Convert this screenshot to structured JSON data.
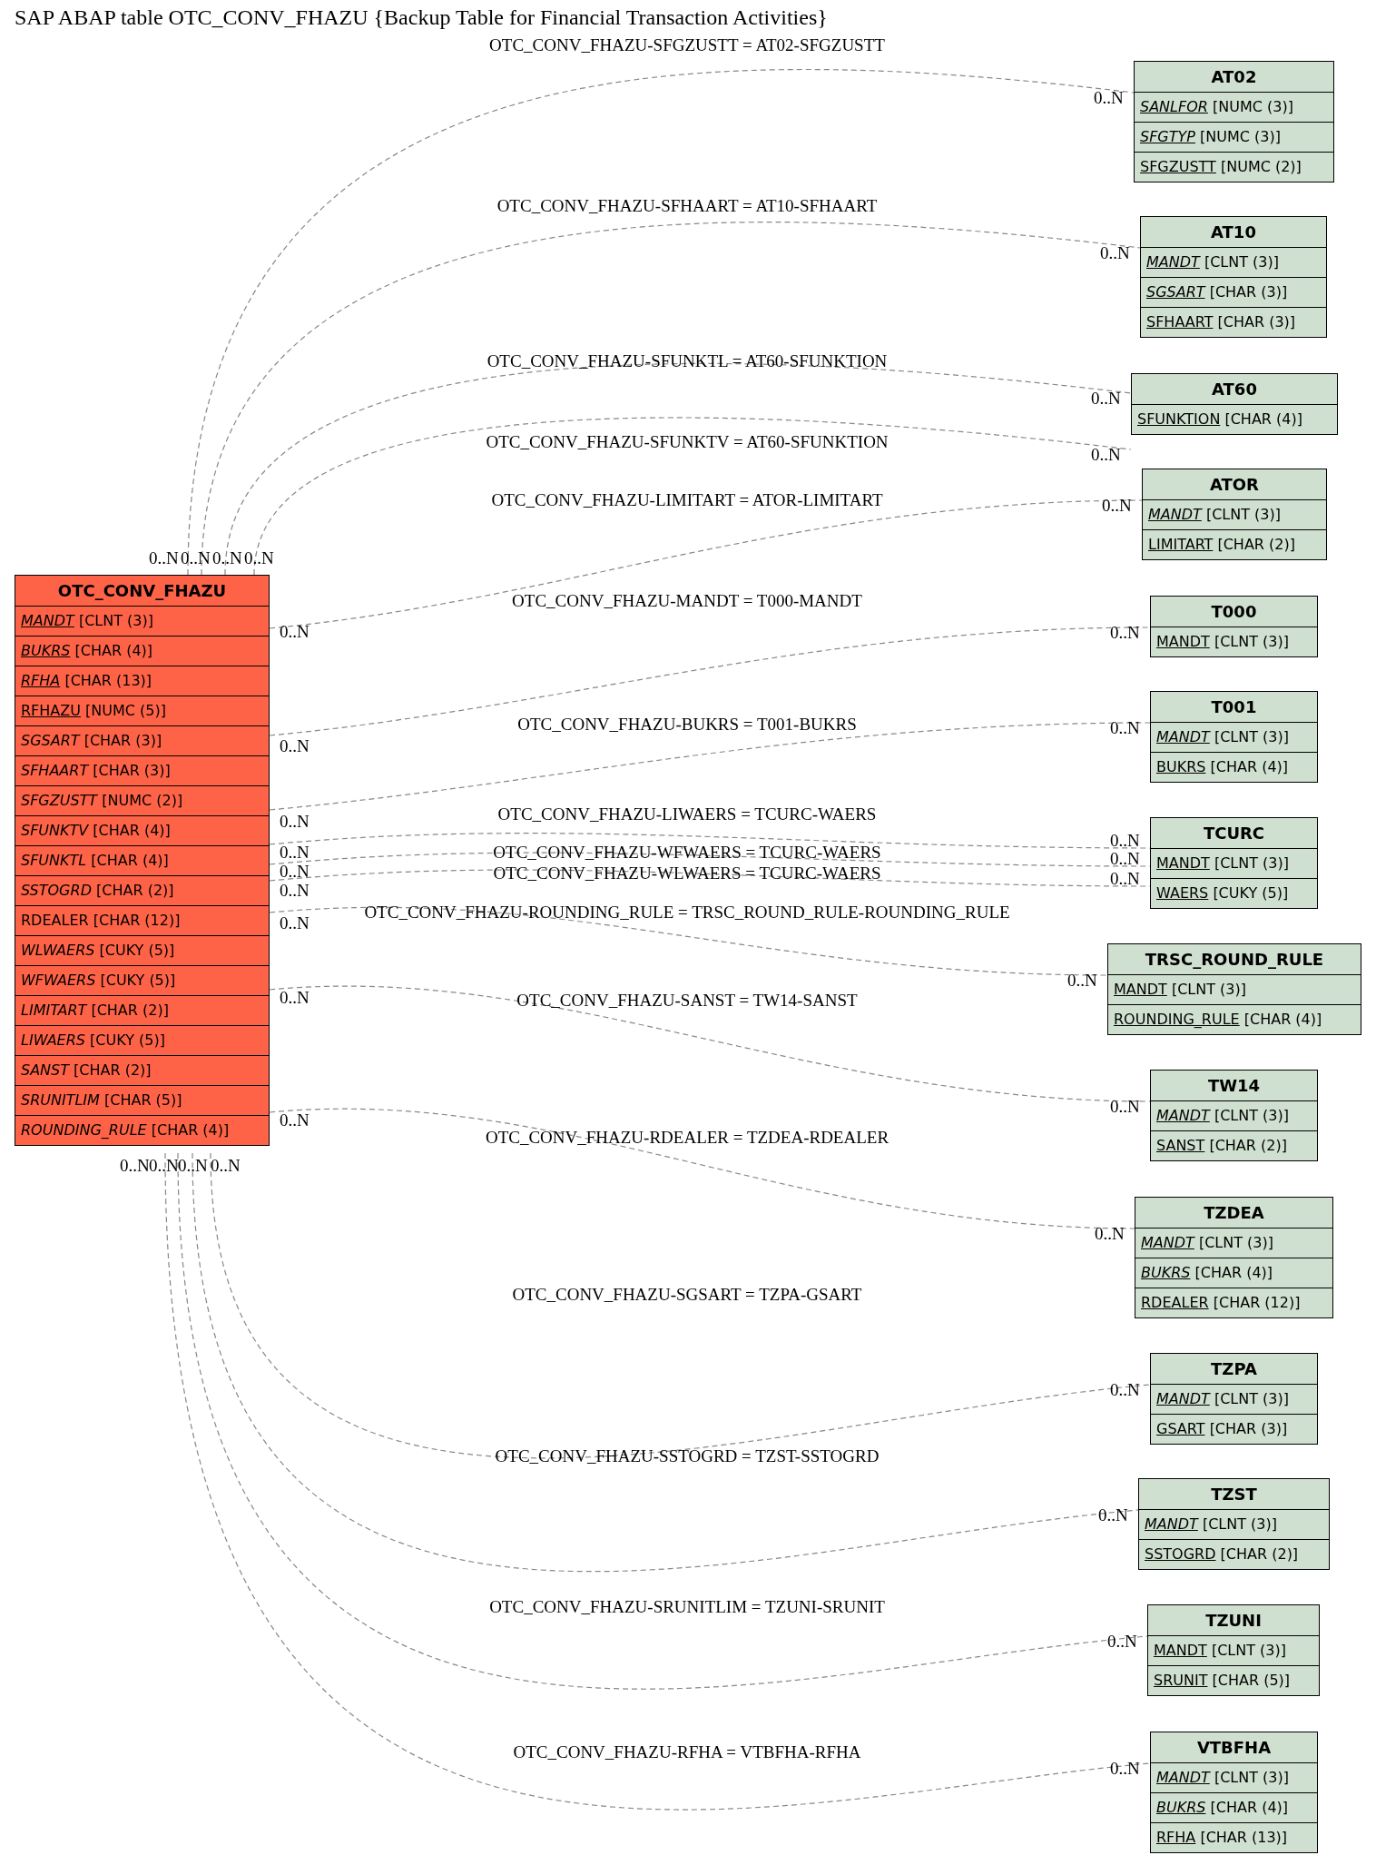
{
  "title": "SAP ABAP table OTC_CONV_FHAZU {Backup Table for Financial Transaction Activities}",
  "main_table": {
    "name": "OTC_CONV_FHAZU",
    "fields": [
      {
        "name": "MANDT",
        "type": "[CLNT (3)]",
        "key": true,
        "italic": true
      },
      {
        "name": "BUKRS",
        "type": "[CHAR (4)]",
        "key": true,
        "italic": true
      },
      {
        "name": "RFHA",
        "type": "[CHAR (13)]",
        "key": true,
        "italic": true
      },
      {
        "name": "RFHAZU",
        "type": "[NUMC (5)]",
        "key": true,
        "italic": false
      },
      {
        "name": "SGSART",
        "type": "[CHAR (3)]",
        "key": false,
        "italic": true
      },
      {
        "name": "SFHAART",
        "type": "[CHAR (3)]",
        "key": false,
        "italic": true
      },
      {
        "name": "SFGZUSTT",
        "type": "[NUMC (2)]",
        "key": false,
        "italic": true
      },
      {
        "name": "SFUNKTV",
        "type": "[CHAR (4)]",
        "key": false,
        "italic": true
      },
      {
        "name": "SFUNKTL",
        "type": "[CHAR (4)]",
        "key": false,
        "italic": true
      },
      {
        "name": "SSTOGRD",
        "type": "[CHAR (2)]",
        "key": false,
        "italic": true
      },
      {
        "name": "RDEALER",
        "type": "[CHAR (12)]",
        "key": false,
        "italic": false
      },
      {
        "name": "WLWAERS",
        "type": "[CUKY (5)]",
        "key": false,
        "italic": true
      },
      {
        "name": "WFWAERS",
        "type": "[CUKY (5)]",
        "key": false,
        "italic": true
      },
      {
        "name": "LIMITART",
        "type": "[CHAR (2)]",
        "key": false,
        "italic": true
      },
      {
        "name": "LIWAERS",
        "type": "[CUKY (5)]",
        "key": false,
        "italic": true
      },
      {
        "name": "SANST",
        "type": "[CHAR (2)]",
        "key": false,
        "italic": true
      },
      {
        "name": "SRUNITLIM",
        "type": "[CHAR (5)]",
        "key": false,
        "italic": true
      },
      {
        "name": "ROUNDING_RULE",
        "type": "[CHAR (4)]",
        "key": false,
        "italic": true
      }
    ]
  },
  "tables": [
    {
      "name": "AT02",
      "fields": [
        {
          "name": "SANLFOR",
          "type": "[NUMC (3)]",
          "key": true,
          "italic": true
        },
        {
          "name": "SFGTYP",
          "type": "[NUMC (3)]",
          "key": true,
          "italic": true
        },
        {
          "name": "SFGZUSTT",
          "type": "[NUMC (2)]",
          "key": true,
          "italic": false
        }
      ],
      "relations": [
        {
          "label": "OTC_CONV_FHAZU-SFGZUSTT = AT02-SFGZUSTT",
          "source_cardinality": "0..N",
          "target_cardinality": "0..N"
        }
      ]
    },
    {
      "name": "AT10",
      "fields": [
        {
          "name": "MANDT",
          "type": "[CLNT (3)]",
          "key": true,
          "italic": true
        },
        {
          "name": "SGSART",
          "type": "[CHAR (3)]",
          "key": true,
          "italic": true
        },
        {
          "name": "SFHAART",
          "type": "[CHAR (3)]",
          "key": true,
          "italic": false
        }
      ],
      "relations": [
        {
          "label": "OTC_CONV_FHAZU-SFHAART = AT10-SFHAART",
          "source_cardinality": "0..N",
          "target_cardinality": "0..N"
        }
      ]
    },
    {
      "name": "AT60",
      "fields": [
        {
          "name": "SFUNKTION",
          "type": "[CHAR (4)]",
          "key": true,
          "italic": false
        }
      ],
      "relations": [
        {
          "label": "OTC_CONV_FHAZU-SFUNKTL = AT60-SFUNKTION",
          "source_cardinality": "0..N",
          "target_cardinality": "0..N"
        },
        {
          "label": "OTC_CONV_FHAZU-SFUNKTV = AT60-SFUNKTION",
          "source_cardinality": "0..N",
          "target_cardinality": "0..N"
        }
      ]
    },
    {
      "name": "ATOR",
      "fields": [
        {
          "name": "MANDT",
          "type": "[CLNT (3)]",
          "key": true,
          "italic": true
        },
        {
          "name": "LIMITART",
          "type": "[CHAR (2)]",
          "key": true,
          "italic": false
        }
      ],
      "relations": [
        {
          "label": "OTC_CONV_FHAZU-LIMITART = ATOR-LIMITART",
          "source_cardinality": "0..N",
          "target_cardinality": "0..N"
        }
      ]
    },
    {
      "name": "T000",
      "fields": [
        {
          "name": "MANDT",
          "type": "[CLNT (3)]",
          "key": true,
          "italic": false
        }
      ],
      "relations": [
        {
          "label": "OTC_CONV_FHAZU-MANDT = T000-MANDT",
          "source_cardinality": "0..N",
          "target_cardinality": "0..N"
        }
      ]
    },
    {
      "name": "T001",
      "fields": [
        {
          "name": "MANDT",
          "type": "[CLNT (3)]",
          "key": true,
          "italic": true
        },
        {
          "name": "BUKRS",
          "type": "[CHAR (4)]",
          "key": true,
          "italic": false
        }
      ],
      "relations": [
        {
          "label": "OTC_CONV_FHAZU-BUKRS = T001-BUKRS",
          "source_cardinality": "0..N",
          "target_cardinality": "0..N"
        }
      ]
    },
    {
      "name": "TCURC",
      "fields": [
        {
          "name": "MANDT",
          "type": "[CLNT (3)]",
          "key": true,
          "italic": false
        },
        {
          "name": "WAERS",
          "type": "[CUKY (5)]",
          "key": true,
          "italic": false
        }
      ],
      "relations": [
        {
          "label": "OTC_CONV_FHAZU-LIWAERS = TCURC-WAERS",
          "source_cardinality": "0..N",
          "target_cardinality": "0..N"
        },
        {
          "label": "OTC_CONV_FHAZU-WFWAERS = TCURC-WAERS",
          "source_cardinality": "0..N",
          "target_cardinality": "0..N"
        },
        {
          "label": "OTC_CONV_FHAZU-WLWAERS = TCURC-WAERS",
          "source_cardinality": "0..N",
          "target_cardinality": "0..N"
        }
      ]
    },
    {
      "name": "TRSC_ROUND_RULE",
      "fields": [
        {
          "name": "MANDT",
          "type": "[CLNT (3)]",
          "key": true,
          "italic": false
        },
        {
          "name": "ROUNDING_RULE",
          "type": "[CHAR (4)]",
          "key": true,
          "italic": false
        }
      ],
      "relations": [
        {
          "label": "OTC_CONV_FHAZU-ROUNDING_RULE = TRSC_ROUND_RULE-ROUNDING_RULE",
          "source_cardinality": "0..N",
          "target_cardinality": "0..N"
        }
      ]
    },
    {
      "name": "TW14",
      "fields": [
        {
          "name": "MANDT",
          "type": "[CLNT (3)]",
          "key": true,
          "italic": true
        },
        {
          "name": "SANST",
          "type": "[CHAR (2)]",
          "key": true,
          "italic": false
        }
      ],
      "relations": [
        {
          "label": "OTC_CONV_FHAZU-SANST = TW14-SANST",
          "source_cardinality": "0..N",
          "target_cardinality": "0..N"
        }
      ]
    },
    {
      "name": "TZDEA",
      "fields": [
        {
          "name": "MANDT",
          "type": "[CLNT (3)]",
          "key": true,
          "italic": true
        },
        {
          "name": "BUKRS",
          "type": "[CHAR (4)]",
          "key": true,
          "italic": true
        },
        {
          "name": "RDEALER",
          "type": "[CHAR (12)]",
          "key": true,
          "italic": false
        }
      ],
      "relations": [
        {
          "label": "OTC_CONV_FHAZU-RDEALER = TZDEA-RDEALER",
          "source_cardinality": "0..N",
          "target_cardinality": "0..N"
        }
      ]
    },
    {
      "name": "TZPA",
      "fields": [
        {
          "name": "MANDT",
          "type": "[CLNT (3)]",
          "key": true,
          "italic": true
        },
        {
          "name": "GSART",
          "type": "[CHAR (3)]",
          "key": true,
          "italic": false
        }
      ],
      "relations": [
        {
          "label": "OTC_CONV_FHAZU-SGSART = TZPA-GSART",
          "source_cardinality": "0..N",
          "target_cardinality": "0..N"
        }
      ]
    },
    {
      "name": "TZST",
      "fields": [
        {
          "name": "MANDT",
          "type": "[CLNT (3)]",
          "key": true,
          "italic": true
        },
        {
          "name": "SSTOGRD",
          "type": "[CHAR (2)]",
          "key": true,
          "italic": false
        }
      ],
      "relations": [
        {
          "label": "OTC_CONV_FHAZU-SSTOGRD = TZST-SSTOGRD",
          "source_cardinality": "0..N",
          "target_cardinality": "0..N"
        }
      ]
    },
    {
      "name": "TZUNI",
      "fields": [
        {
          "name": "MANDT",
          "type": "[CLNT (3)]",
          "key": true,
          "italic": false
        },
        {
          "name": "SRUNIT",
          "type": "[CHAR (5)]",
          "key": true,
          "italic": false
        }
      ],
      "relations": [
        {
          "label": "OTC_CONV_FHAZU-SRUNITLIM = TZUNI-SRUNIT",
          "source_cardinality": "0..N",
          "target_cardinality": "0..N"
        }
      ]
    },
    {
      "name": "VTBFHA",
      "fields": [
        {
          "name": "MANDT",
          "type": "[CLNT (3)]",
          "key": true,
          "italic": true
        },
        {
          "name": "BUKRS",
          "type": "[CHAR (4)]",
          "key": true,
          "italic": true
        },
        {
          "name": "RFHA",
          "type": "[CHAR (13)]",
          "key": true,
          "italic": false
        }
      ],
      "relations": [
        {
          "label": "OTC_CONV_FHAZU-RFHA = VTBFHA-RFHA",
          "source_cardinality": "0..N",
          "target_cardinality": "0..N"
        }
      ]
    }
  ]
}
